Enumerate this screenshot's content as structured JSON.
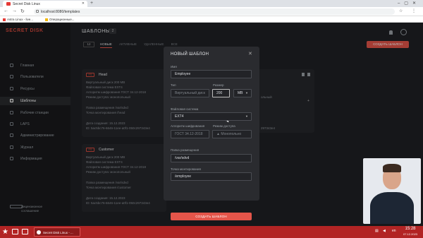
{
  "browser": {
    "tab_title": "Secret Disk Linux",
    "url": "localhost:8080/templates",
    "bookmarks": [
      "Astra Linux - live...",
      "Операционные..."
    ]
  },
  "sidebar": {
    "logo": "SECRET DISK",
    "items": [
      {
        "label": "Главная"
      },
      {
        "label": "Пользователи"
      },
      {
        "label": "Ресурсы"
      },
      {
        "label": "Шаблоны"
      },
      {
        "label": "Рабочие станции"
      },
      {
        "label": "LAPS"
      },
      {
        "label": "Администрирование"
      },
      {
        "label": "Журнал"
      },
      {
        "label": "Информация"
      }
    ],
    "footer": [
      "Лицензионное",
      "соглашение"
    ]
  },
  "header": {
    "title": "ШАБЛОНЫ",
    "count": "2",
    "create_button": "СОЗДАТЬ ШАБЛОН",
    "filter_value": "12",
    "filters": [
      "НОВЫЕ",
      "АКТИВНЫЕ",
      "УДАЛЕННЫЕ",
      "ВСЕ"
    ]
  },
  "cards": [
    {
      "tag": "FS",
      "name": "Head",
      "lines": [
        "Виртуальный диск 200 MB",
        "Файловая система EXT4",
        "Алгоритм шифрования ГОСТ 34.12-2018",
        "Режим доступа: монопольный",
        "",
        "Папка размещения /var/sdvd",
        "Точка монтирования /head",
        "",
        "Дата создания: 15.12.2023",
        "ID: 5ac5bc76-6646-11ee-a0f1-050c297343e4"
      ]
    },
    {
      "tag": "FS",
      "name": "Customer",
      "lines": [
        "Виртуальный диск 200 MB",
        "Файловая система EXT4",
        "Алгоритм шифрования ГОСТ 34.12-2018",
        "Режим доступа: монопольный",
        "",
        "Папка размещения /var/sdvd",
        "Точка монтирования /customer",
        "",
        "Дата создания: 15.12.2023",
        "ID: 5ac5bc76-6646-11ee-a0f1-050c297343e4"
      ]
    }
  ],
  "right_card_lines": [
    "ольный",
    "",
    "",
    "297343e4"
  ],
  "modal": {
    "title": "НОВЫЙ ШАБЛОН",
    "name_label": "Имя",
    "name_value": "Employee",
    "type_label": "Тип",
    "type_value": "Виртуальный диск",
    "size_label": "Размер",
    "size_value": "200",
    "unit_value": "MB",
    "fs_label": "Файловая система",
    "fs_value": "EXT4",
    "algo_label": "Алгоритм шифрования",
    "algo_value": "ГОСТ 34.12-2018",
    "access_label": "Режим доступа",
    "access_value": "Монопольно",
    "folder_label": "Папка размещения",
    "folder_value": "/var/sdvd",
    "mount_label": "Точка монтирования",
    "mount_value": "/employee",
    "create_button": "СОЗДАТЬ ШАБЛОН"
  },
  "taskbar": {
    "task_label": "Secret Disk Linux - ...",
    "lang": "en",
    "time": "15:28",
    "date": "07.12.2023"
  }
}
